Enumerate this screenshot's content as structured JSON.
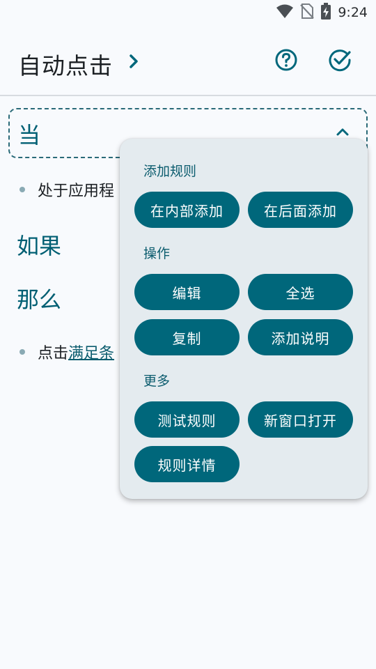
{
  "status_bar": {
    "time": "9:24",
    "icons": [
      "wifi-icon",
      "no-sim-icon",
      "battery-charging-icon"
    ]
  },
  "app_bar": {
    "title": "自动点击",
    "title_chevron_icon": "chevron-right-icon",
    "help_icon": "help-circle-icon",
    "done_icon": "check-circle-icon"
  },
  "rule": {
    "when_label": "当",
    "collapse_icon": "chevron-up-icon",
    "condition_text": "处于应用程",
    "if_label": "如果",
    "then_label": "那么",
    "action_prefix": "点击",
    "action_link": "满足条"
  },
  "popup_menu": {
    "sections": [
      {
        "title": "添加规则",
        "buttons": [
          "在内部添加",
          "在后面添加"
        ]
      },
      {
        "title": "操作",
        "buttons": [
          "编辑",
          "全选",
          "复制",
          "添加说明"
        ]
      },
      {
        "title": "更多",
        "buttons": [
          "测试规则",
          "新窗口打开",
          "规则详情"
        ]
      }
    ]
  },
  "colors": {
    "accent": "#00677b",
    "background": "#f8fafd",
    "popup_bg": "#e4ebef",
    "section_text": "#005f73"
  }
}
